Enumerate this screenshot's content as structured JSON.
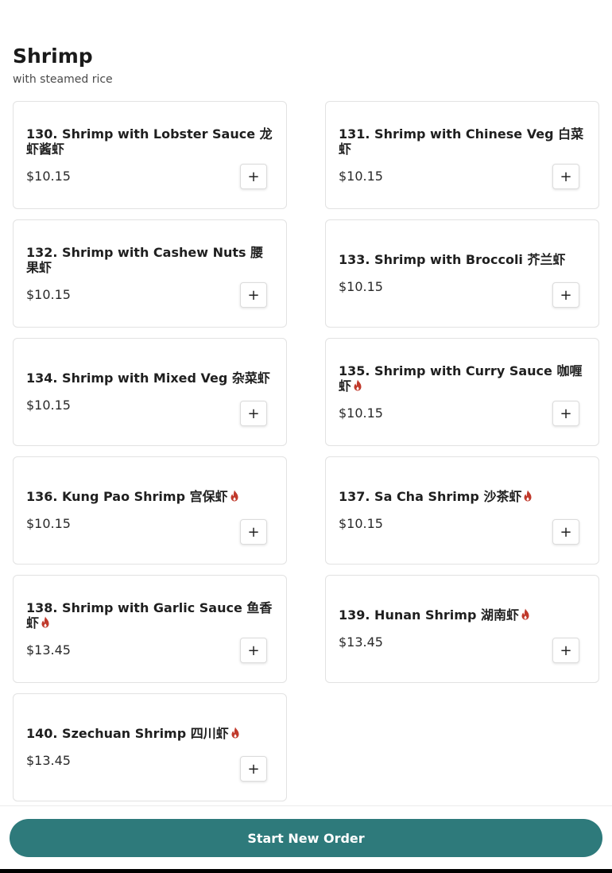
{
  "section": {
    "title": "Shrimp",
    "subtitle": "with steamed rice"
  },
  "add_label": "+",
  "spicy_icon": "flame-icon",
  "spicy_color": "#c0392b",
  "items": [
    {
      "name": "130. Shrimp with Lobster Sauce",
      "chinese": "龙虾酱虾",
      "price": "$10.15",
      "spicy": false
    },
    {
      "name": "131. Shrimp with Chinese Veg",
      "chinese": "白菜虾",
      "price": "$10.15",
      "spicy": false
    },
    {
      "name": "132. Shrimp with Cashew Nuts",
      "chinese": "腰果虾",
      "price": "$10.15",
      "spicy": false
    },
    {
      "name": "133. Shrimp with Broccoli",
      "chinese": "芥兰虾",
      "price": "$10.15",
      "spicy": false
    },
    {
      "name": "134. Shrimp with Mixed Veg",
      "chinese": "杂菜虾",
      "price": "$10.15",
      "spicy": false
    },
    {
      "name": "135. Shrimp with Curry Sauce",
      "chinese": "咖喱虾",
      "price": "$10.15",
      "spicy": true
    },
    {
      "name": "136. Kung Pao Shrimp",
      "chinese": "宫保虾",
      "price": "$10.15",
      "spicy": true
    },
    {
      "name": "137. Sa Cha Shrimp",
      "chinese": "沙茶虾",
      "price": "$10.15",
      "spicy": true
    },
    {
      "name": "138. Shrimp with Garlic Sauce",
      "chinese": "鱼香虾",
      "price": "$13.45",
      "spicy": true
    },
    {
      "name": "139. Hunan Shrimp",
      "chinese": "湖南虾",
      "price": "$13.45",
      "spicy": true
    },
    {
      "name": "140. Szechuan Shrimp",
      "chinese": "四川虾",
      "price": "$13.45",
      "spicy": true
    }
  ],
  "footer": {
    "start_order_label": "Start New Order",
    "button_color": "#2e7a7b"
  }
}
